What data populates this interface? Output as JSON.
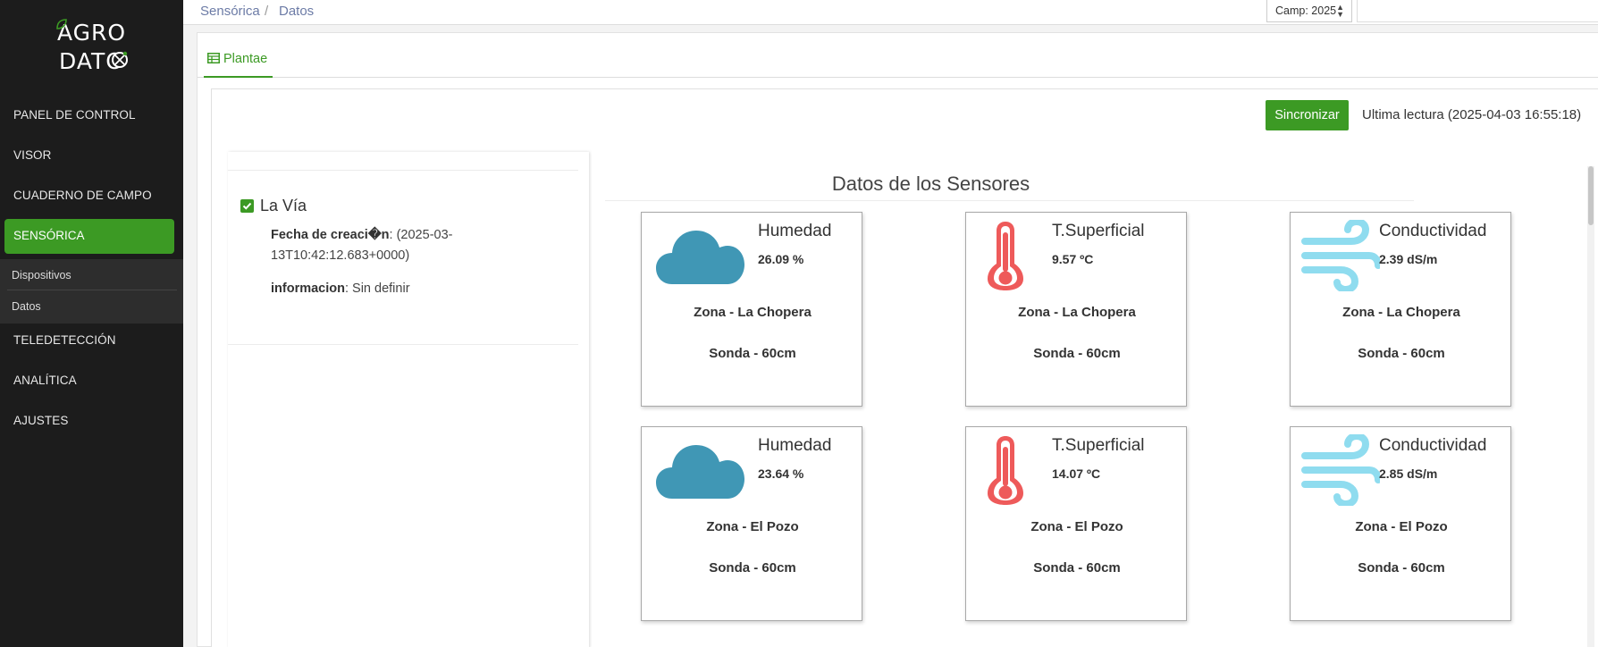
{
  "logo": {
    "line1": "AGRO",
    "line2": "DATO"
  },
  "sidebar": {
    "items": [
      {
        "label": "PANEL DE CONTROL"
      },
      {
        "label": "VISOR"
      },
      {
        "label": "CUADERNO DE CAMPO"
      },
      {
        "label": "SENSÓRICA"
      },
      {
        "label": "TELEDETECCIÓN"
      },
      {
        "label": "ANALÍTICA"
      },
      {
        "label": "AJUSTES"
      }
    ],
    "submenu": [
      {
        "label": "Dispositivos"
      },
      {
        "label": "Datos"
      }
    ]
  },
  "breadcrumb": {
    "parent": "Sensórica",
    "separator": "/",
    "current": "Datos"
  },
  "campaign": {
    "selected": "Camp: 2025"
  },
  "tab": {
    "label": "Plantae"
  },
  "sync": {
    "button": "Sincronizar",
    "last_reading": "Ultima lectura (2025-04-03 16:55:18)"
  },
  "location": {
    "name": "La Vía",
    "created_label": "Fecha de creaci�n",
    "created_line1": ": (2025-03-",
    "created_line2": "13T10:42:12.683+0000)",
    "info_label": "informacion",
    "info_value": ": Sin definir"
  },
  "sensors": {
    "title": "Datos de los Sensores",
    "cards": [
      {
        "type": "Humedad",
        "value": "26.09 %",
        "zone": "Zona - La Chopera",
        "probe": "Sonda - 60cm",
        "icon": "cloud-icon",
        "color": "#4097b5"
      },
      {
        "type": "T.Superficial",
        "value": "9.57 ºC",
        "zone": "Zona - La Chopera",
        "probe": "Sonda - 60cm",
        "icon": "thermometer-icon",
        "color": "#ee5a5a"
      },
      {
        "type": "Conductividad",
        "value": "2.39 dS/m",
        "zone": "Zona - La Chopera",
        "probe": "Sonda - 60cm",
        "icon": "wind-icon",
        "color": "#8fdcef"
      },
      {
        "type": "Humedad",
        "value": "23.64 %",
        "zone": "Zona - El Pozo",
        "probe": "Sonda - 60cm",
        "icon": "cloud-icon",
        "color": "#4097b5"
      },
      {
        "type": "T.Superficial",
        "value": "14.07 ºC",
        "zone": "Zona - El Pozo",
        "probe": "Sonda - 60cm",
        "icon": "thermometer-icon",
        "color": "#ee5a5a"
      },
      {
        "type": "Conductividad",
        "value": "2.85 dS/m",
        "zone": "Zona - El Pozo",
        "probe": "Sonda - 60cm",
        "icon": "wind-icon",
        "color": "#8fdcef"
      }
    ]
  },
  "colors": {
    "accent": "#3c9a24",
    "sidebar": "#1c1c1c",
    "link": "#6c7ba6"
  }
}
